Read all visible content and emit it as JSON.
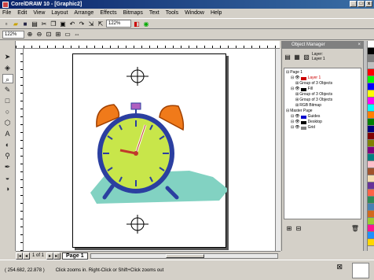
{
  "window": {
    "title": "CorelDRAW 10 - [Graphic2]",
    "min": "_",
    "max": "□",
    "close": "x"
  },
  "menu": [
    "File",
    "Edit",
    "View",
    "Layout",
    "Arrange",
    "Effects",
    "Bitmaps",
    "Text",
    "Tools",
    "Window",
    "Help"
  ],
  "toolbar": {
    "zoom_value": "122%",
    "view_combo": "122%"
  },
  "statusbar": {
    "coords": "( 254.682, 22.878 )",
    "hint": "Click zooms in. Right-Click or Shift+Click zooms out"
  },
  "pagenav": {
    "counter": "1 of 1",
    "tab": "Page 1"
  },
  "object_manager": {
    "title": "Object Manager",
    "layer_label": "Layer:",
    "layer_value": "Layer 1",
    "tree": [
      {
        "indent": 0,
        "label": "Page 1",
        "kind": "page"
      },
      {
        "indent": 1,
        "label": "Layer 1",
        "kind": "layer",
        "color": "#cc0000"
      },
      {
        "indent": 2,
        "label": "Group of 3 Objects",
        "kind": "group"
      },
      {
        "indent": 1,
        "label": "Fill",
        "kind": "layer",
        "color": "#000000"
      },
      {
        "indent": 2,
        "label": "Group of 3 Objects",
        "kind": "group"
      },
      {
        "indent": 2,
        "label": "Group of 3 Objects",
        "kind": "group"
      },
      {
        "indent": 2,
        "label": "RGB Bitmap",
        "kind": "bitmap"
      },
      {
        "indent": 0,
        "label": "Master Page",
        "kind": "page"
      },
      {
        "indent": 1,
        "label": "Guides",
        "kind": "layer",
        "color": "#0000cc"
      },
      {
        "indent": 1,
        "label": "Desktop",
        "kind": "layer",
        "color": "#000000"
      },
      {
        "indent": 1,
        "label": "Grid",
        "kind": "layer",
        "color": "#808080"
      }
    ]
  },
  "palette": [
    "#ffffff",
    "#000000",
    "#808080",
    "#c0c0c0",
    "#ff0000",
    "#00ff00",
    "#0000ff",
    "#ffff00",
    "#ff00ff",
    "#00ffff",
    "#ff8000",
    "#008000",
    "#000080",
    "#800000",
    "#808000",
    "#800080",
    "#008080",
    "#ffc0cb",
    "#a0522d",
    "#f5deb3",
    "#663399",
    "#ff6347",
    "#2e8b57",
    "#4682b4",
    "#d2691e",
    "#9acd32",
    "#ff1493",
    "#1e90ff",
    "#ffd700"
  ],
  "colors": {
    "clock_face": "#c8e64a",
    "clock_rim": "#2b3fa0",
    "bells": "#f07a1a",
    "shadow": "#82d2c2",
    "hands": "#c0392b"
  }
}
